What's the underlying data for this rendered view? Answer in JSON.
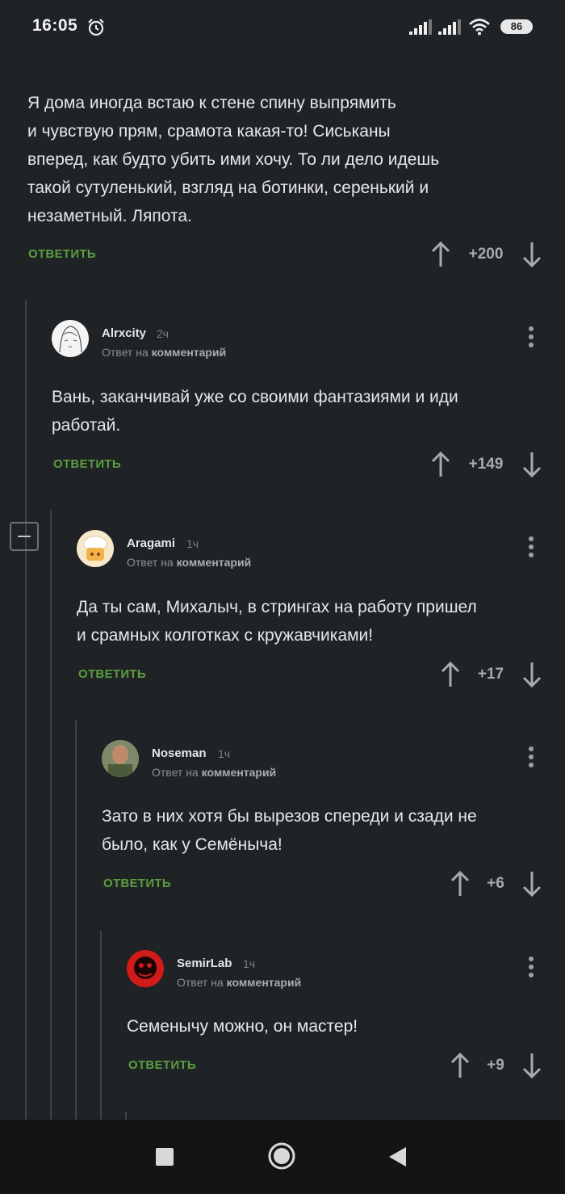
{
  "status_bar": {
    "time": "16:05",
    "battery": "86"
  },
  "root_comment": {
    "lines": [
      "Я дома иногда встаю к стене спину выпрямить",
      "и чувствую прям, срамота какая-то! Сиськаны",
      "вперед, как будто убить ими хочу. То ли дело идешь",
      "такой сутуленький, взгляд на ботинки, серенький и",
      "незаметный. Ляпота."
    ],
    "reply_label": "ОТВЕТИТЬ",
    "score": "+200"
  },
  "comments": [
    {
      "username": "Alrxcity",
      "time": "2ч",
      "reply_prefix": "Ответ на",
      "reply_target": "комментарий",
      "lines": [
        "Вань, заканчивай уже со своими фантазиями и иди",
        "работай."
      ],
      "reply_label": "ОТВЕТИТЬ",
      "score": "+149"
    },
    {
      "username": "Aragami",
      "time": "1ч",
      "reply_prefix": "Ответ на",
      "reply_target": "комментарий",
      "lines": [
        "Да ты сам, Михалыч, в стрингах на работу пришел",
        "и срамных колготках с кружавчиками!"
      ],
      "reply_label": "ОТВЕТИТЬ",
      "score": "+17"
    },
    {
      "username": "Noseman",
      "time": "1ч",
      "reply_prefix": "Ответ на",
      "reply_target": "комментарий",
      "lines": [
        "Зато в них хотя бы вырезов спереди и сзади не",
        "было, как у Семёныча!"
      ],
      "reply_label": "ОТВЕТИТЬ",
      "score": "+6"
    },
    {
      "username": "SemirLab",
      "time": "1ч",
      "reply_prefix": "Ответ на",
      "reply_target": "комментарий",
      "lines": [
        "Семенычу можно, он мастер!"
      ],
      "reply_label": "ОТВЕТИТЬ",
      "score": "+9"
    }
  ],
  "colors": {
    "background": "#202326",
    "reply_green": "#5a9e3f",
    "thread_line": "#3f4348"
  }
}
